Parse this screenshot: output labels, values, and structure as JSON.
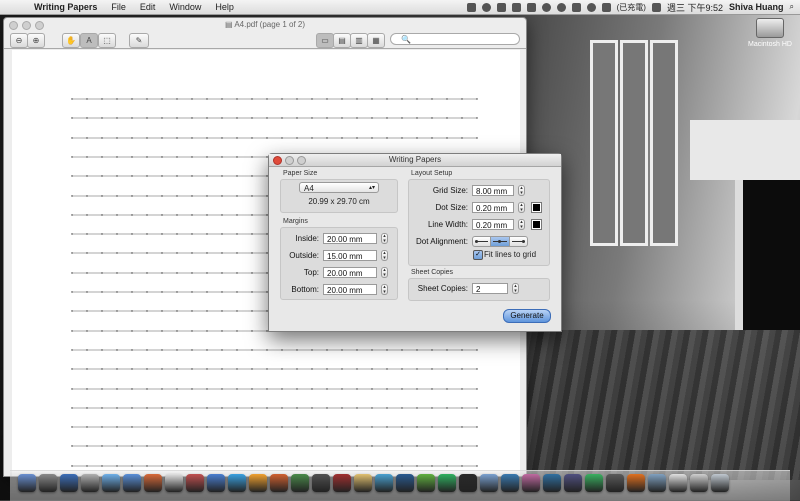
{
  "menubar": {
    "app_name": "Writing Papers",
    "items": [
      "File",
      "Edit",
      "Window",
      "Help"
    ],
    "input_method": "(已充電)",
    "datetime": "週三 下午9:52",
    "user": "Shiva Huang"
  },
  "desktop": {
    "hd_label": "Macintosh HD"
  },
  "preview": {
    "title": "A4.pdf (page 1 of 2)",
    "toolbar": {
      "zoom_out": "⊖",
      "zoom_in": "⊕",
      "hand": "✋",
      "text_select": "A",
      "rect_select": "⬚",
      "annotate": "✎",
      "view_single": "▭",
      "view_sidebar": "▤",
      "view_two": "▥",
      "view_sheet": "▦",
      "search_placeholder": "🔍"
    }
  },
  "dialog": {
    "title": "Writing Papers",
    "paper_size": {
      "group_label": "Paper Size",
      "selected": "A4",
      "dimensions": "20.99 x 29.70 cm"
    },
    "margins": {
      "group_label": "Margins",
      "rows": [
        {
          "label": "Inside:",
          "value": "20.00 mm"
        },
        {
          "label": "Outside:",
          "value": "15.00 mm"
        },
        {
          "label": "Top:",
          "value": "20.00 mm"
        },
        {
          "label": "Bottom:",
          "value": "20.00 mm"
        }
      ]
    },
    "layout": {
      "group_label": "Layout Setup",
      "grid_size_label": "Grid Size:",
      "grid_size": "8.00 mm",
      "dot_size_label": "Dot Size:",
      "dot_size": "0.20 mm",
      "line_width_label": "Line Width:",
      "line_width": "0.20 mm",
      "dot_alignment_label": "Dot Alignment:",
      "fit_lines_label": "Fit lines to grid",
      "fit_lines_checked": true
    },
    "sheet_copies": {
      "group_label": "Sheet Copies",
      "label": "Sheet Copies:",
      "value": "2"
    },
    "generate_label": "Generate"
  }
}
